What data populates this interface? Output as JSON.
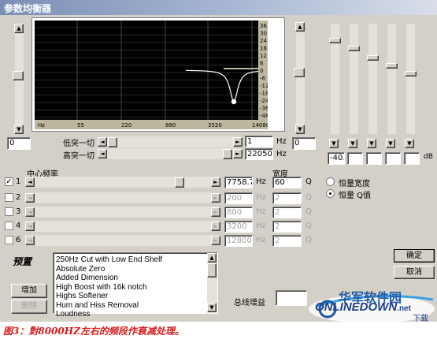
{
  "window": {
    "title": "参数均衡器"
  },
  "graph": {
    "db_labels": [
      "36",
      "30",
      "24",
      "18",
      "12",
      "6",
      "0",
      "-6",
      "-12",
      "-18",
      "-24",
      "-36",
      "-48"
    ],
    "freq_labels": [
      "Hz",
      "55",
      "220",
      "880",
      "3520",
      "14080"
    ],
    "curve_color": "#ffffff",
    "background_color": "#000000",
    "axis_strip_color": "#bdb79e",
    "grid_color": "#8a8a8a",
    "handle_color": "#ffffff"
  },
  "left_value": "0",
  "lowcut": {
    "label": "低突一切",
    "value": "1",
    "unit": "Hz"
  },
  "highcut": {
    "label": "高突一切",
    "value": "22050",
    "unit": "Hz"
  },
  "right_value": "0",
  "mixer": {
    "value": "-40.",
    "unit": "dB"
  },
  "bands_header": {
    "center_freq": "中心频率",
    "width": "宽度"
  },
  "bands": [
    {
      "index": "1",
      "checked": true,
      "checkmark": "✓",
      "freq": "7758.7",
      "unit": "Hz",
      "width": "60",
      "q": "Q"
    },
    {
      "index": "2",
      "checked": false,
      "checkmark": "",
      "freq": "200",
      "unit": "Hz",
      "width": "2",
      "q": "Q"
    },
    {
      "index": "3",
      "checked": false,
      "checkmark": "",
      "freq": "800",
      "unit": "Hz",
      "width": "2",
      "q": "Q"
    },
    {
      "index": "4",
      "checked": false,
      "checkmark": "",
      "freq": "3200",
      "unit": "Hz",
      "width": "2",
      "q": "Q"
    },
    {
      "index": "6",
      "checked": false,
      "checkmark": "",
      "freq": "12800",
      "unit": "Hz",
      "width": "2",
      "q": "Q"
    }
  ],
  "mode": {
    "option1": "恒量宽度",
    "option2": "恒量 Q值",
    "selected": "option2"
  },
  "presets": {
    "title": "预置",
    "add_label": "增加",
    "delete_label": "删除",
    "items": [
      "250Hz Cut with Low End Shelf",
      "Absolute Zero",
      "Added Dimension",
      "High Boost with 16k notch",
      "Highs Softener",
      "Hum and Hiss Removal",
      "Loudness"
    ]
  },
  "master_gain": {
    "label": "总线增益"
  },
  "buttons": {
    "ok": "确定",
    "cancel": "取消"
  },
  "caption": "图3：對8000HZ左右的频段作衰减处理。",
  "watermark": {
    "cn": "华军软件园",
    "en": "ONLINEDOWN",
    "suffix": ".net",
    "cn2": "下载"
  }
}
